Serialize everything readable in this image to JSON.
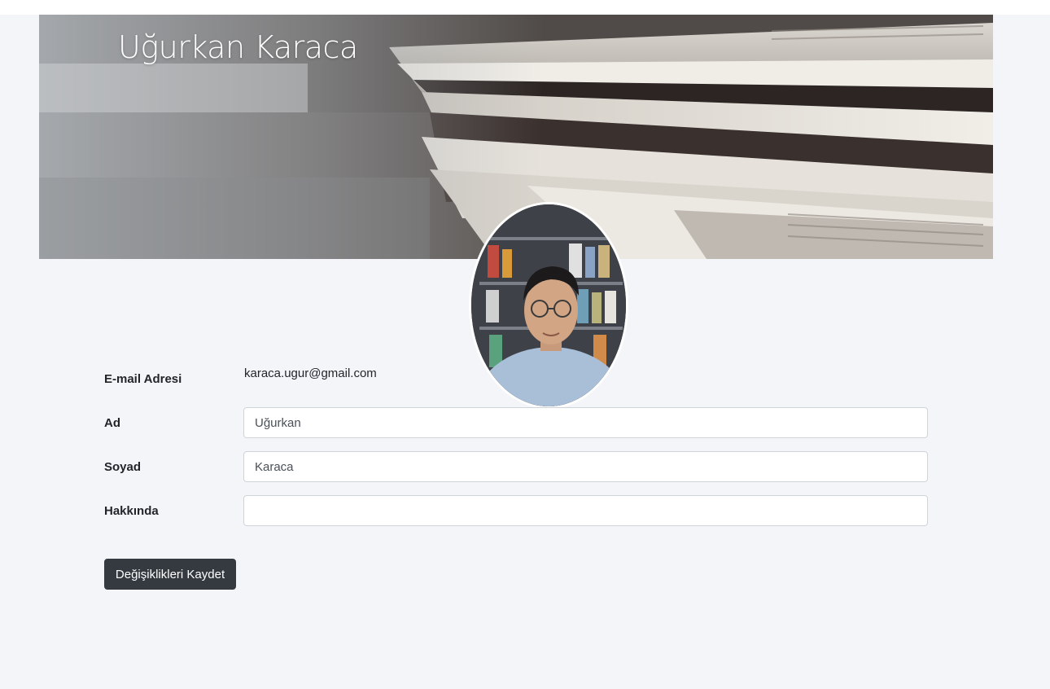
{
  "profile": {
    "name": "Uğurkan Karaca"
  },
  "form": {
    "email_label": "E-mail Adresi",
    "email_value": "karaca.ugur@gmail.com",
    "first_name_label": "Ad",
    "first_name_value": "Uğurkan",
    "last_name_label": "Soyad",
    "last_name_value": "Karaca",
    "about_label": "Hakkında",
    "about_value": "",
    "save_label": "Değişiklikleri Kaydet"
  },
  "images": {
    "banner": "newspaper-stack-photo",
    "avatar": "user-profile-photo"
  },
  "colors": {
    "page_background": "#f4f5f9",
    "button_background": "#343a40",
    "button_text": "#ffffff",
    "input_border": "#ced4da"
  }
}
